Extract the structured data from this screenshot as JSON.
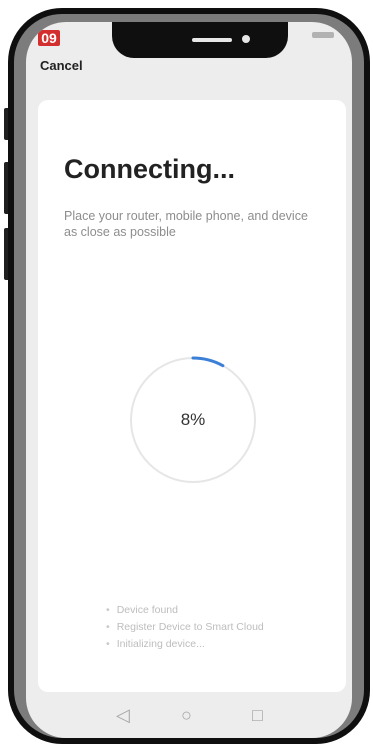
{
  "status_bar": {
    "badge_text": "09"
  },
  "header": {
    "cancel_label": "Cancel"
  },
  "main": {
    "title": "Connecting...",
    "subtitle": "Place your router, mobile phone, and device as close as possible",
    "progress": {
      "value_percent": 8,
      "label": "8%",
      "accent_color": "#3c7fd6",
      "track_color": "#e6e6e6"
    },
    "steps": [
      {
        "label": "Device found"
      },
      {
        "label": "Register Device to Smart Cloud"
      },
      {
        "label": "Initializing device..."
      }
    ]
  },
  "navbar": {
    "back_glyph": "◁",
    "home_glyph": "○",
    "recents_glyph": "□"
  }
}
